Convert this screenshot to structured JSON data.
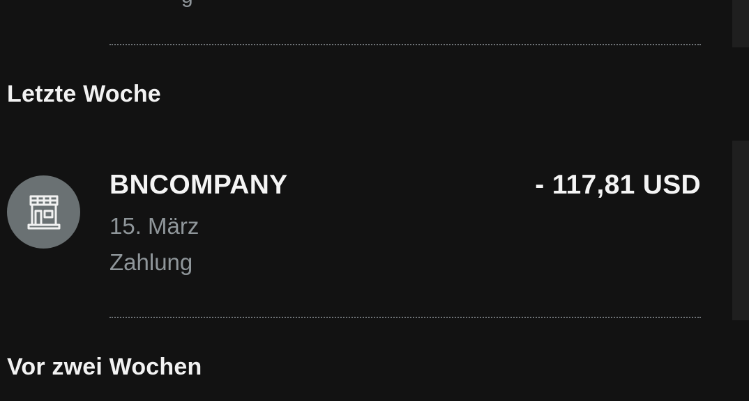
{
  "previous_item": {
    "partial_text": "g"
  },
  "sections": [
    {
      "header": "Letzte Woche",
      "transactions": [
        {
          "icon": "store-icon",
          "name": "BNCOMPANY",
          "amount": "- 117,81 USD",
          "date": "15. März",
          "type": "Zahlung"
        }
      ]
    },
    {
      "header": "Vor zwei Wochen"
    }
  ],
  "colors": {
    "background": "#121212",
    "icon_circle": "#6a7173",
    "secondary_text": "#8f969a",
    "primary_text": "#f4f4f4"
  }
}
